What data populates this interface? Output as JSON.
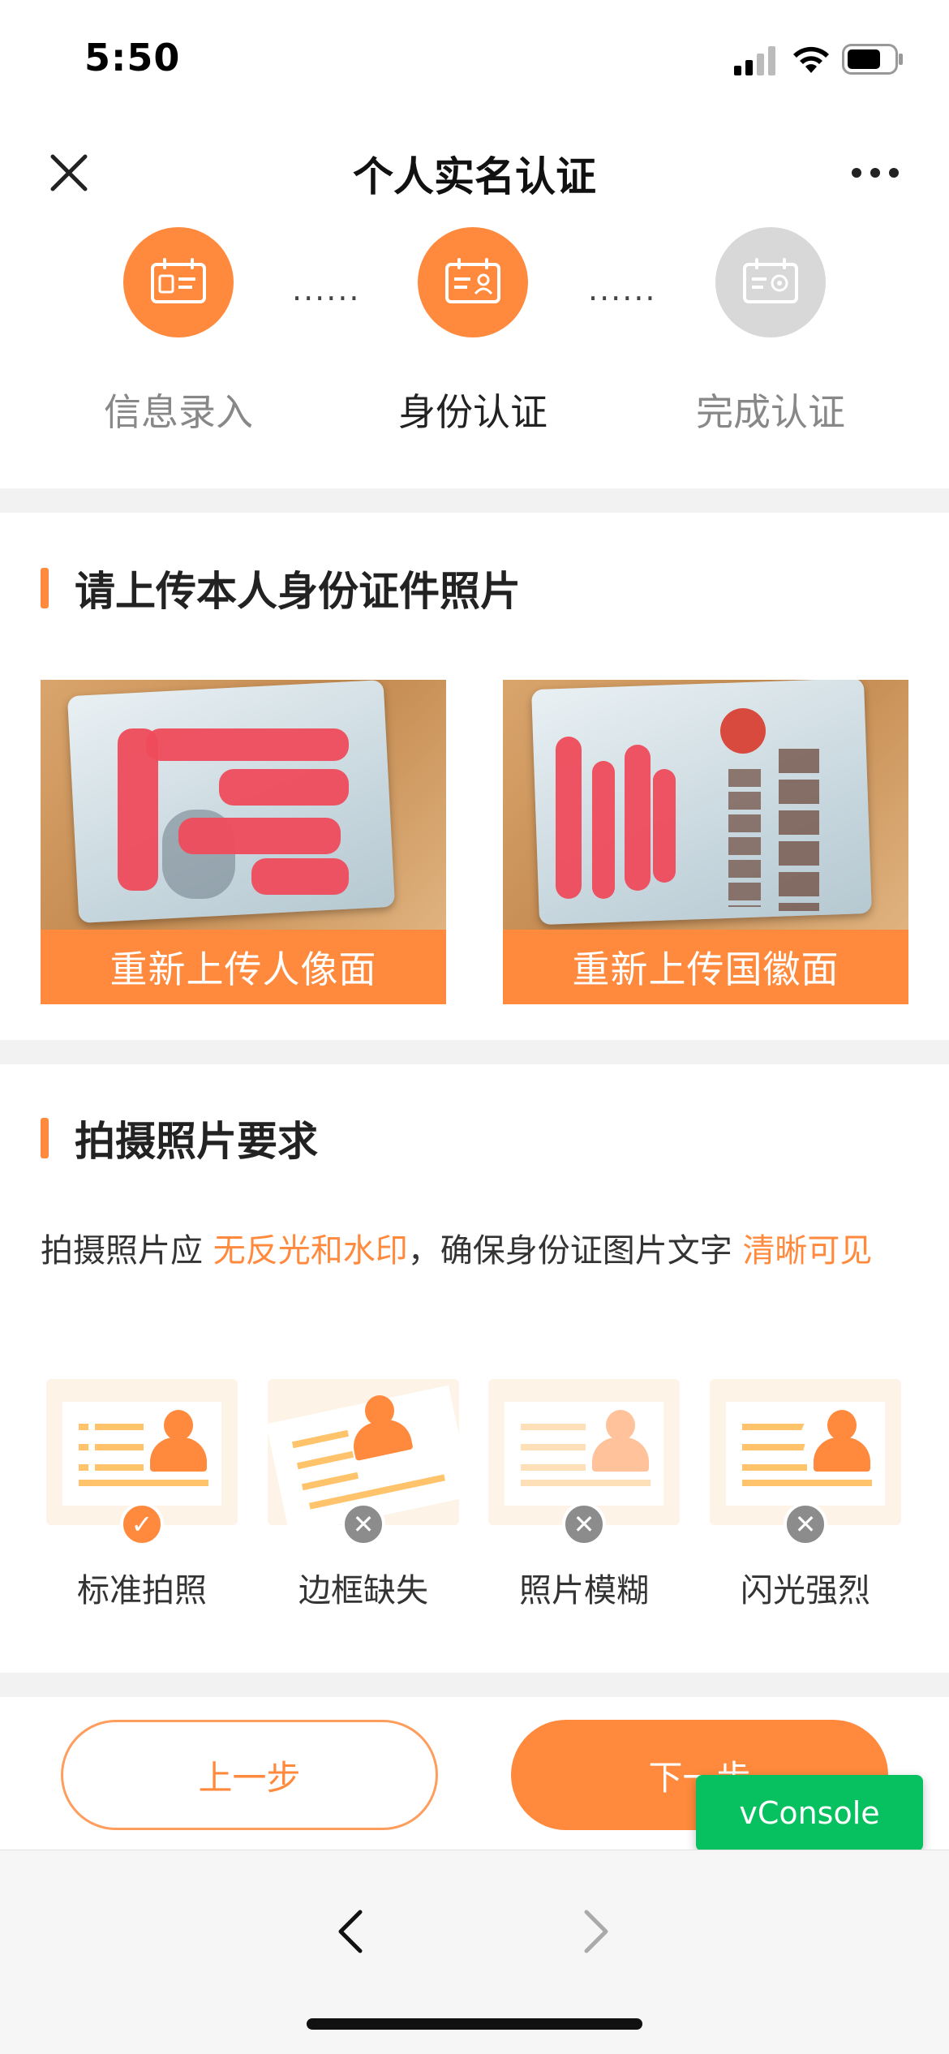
{
  "status_bar": {
    "time": "5:50"
  },
  "nav": {
    "title": "个人实名认证"
  },
  "steps": [
    {
      "label": "信息录入",
      "icon": "id-card-icon",
      "state": "done"
    },
    {
      "label": "身份认证",
      "icon": "id-card-person-icon",
      "state": "current"
    },
    {
      "label": "完成认证",
      "icon": "id-card-check-icon",
      "state": "pending"
    }
  ],
  "step_separator": "······",
  "upload_section": {
    "title": "请上传本人身份证件照片",
    "cards": [
      {
        "button_label": "重新上传人像面"
      },
      {
        "button_label": "重新上传国徽面"
      }
    ]
  },
  "requirements": {
    "title": "拍摄照片要求",
    "text_part1": "拍摄照片应 ",
    "text_highlight1": "无反光和水印",
    "text_part2": "，确保身份证图片文字 ",
    "text_highlight2": "清晰可见",
    "examples": [
      {
        "label": "标准拍照",
        "status": "ok"
      },
      {
        "label": "边框缺失",
        "status": "bad"
      },
      {
        "label": "照片模糊",
        "status": "bad"
      },
      {
        "label": "闪光强烈",
        "status": "bad"
      }
    ]
  },
  "buttons": {
    "prev": "上一步",
    "next": "下一步",
    "vconsole": "vConsole"
  },
  "colors": {
    "accent": "#ff8a3d",
    "vconsole": "#07c160"
  }
}
